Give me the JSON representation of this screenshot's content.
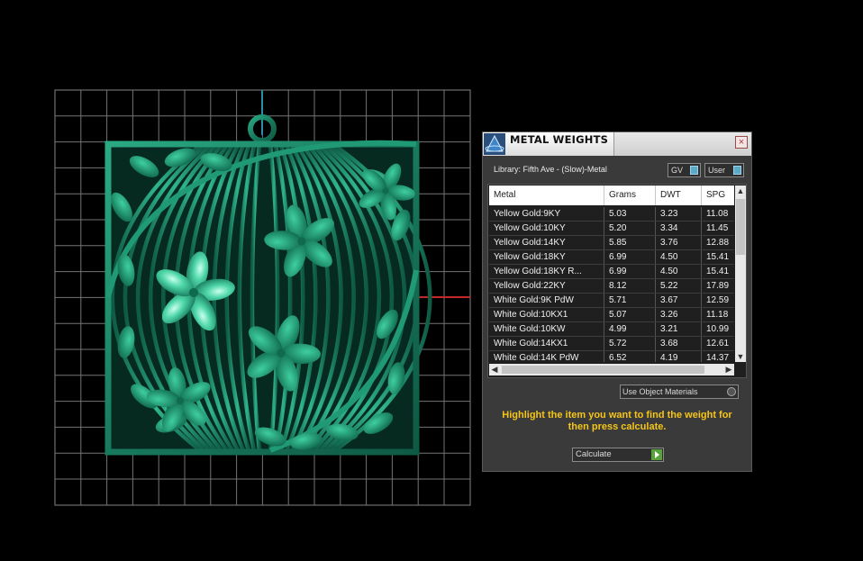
{
  "dialog": {
    "title": "METAL WEIGHTS",
    "close_icon": "close-icon",
    "library_label": "Library: Fifth Ave - (Slow)-Metal",
    "gv_toggle": "GV",
    "user_toggle": "User",
    "use_object_materials": "Use Object Materials",
    "instructions": "Highlight the item you want to find the weight for then press calculate.",
    "calculate_label": "Calculate"
  },
  "table": {
    "headers": [
      "Metal",
      "Grams",
      "DWT",
      "SPG"
    ],
    "rows": [
      [
        "Yellow Gold:9KY",
        "5.03",
        "3.23",
        "11.08"
      ],
      [
        "Yellow Gold:10KY",
        "5.20",
        "3.34",
        "11.45"
      ],
      [
        "Yellow Gold:14KY",
        "5.85",
        "3.76",
        "12.88"
      ],
      [
        "Yellow Gold:18KY",
        "6.99",
        "4.50",
        "15.41"
      ],
      [
        "Yellow Gold:18KY R...",
        "6.99",
        "4.50",
        "15.41"
      ],
      [
        "Yellow Gold:22KY",
        "8.12",
        "5.22",
        "17.89"
      ],
      [
        "White Gold:9K PdW",
        "5.71",
        "3.67",
        "12.59"
      ],
      [
        "White Gold:10KX1",
        "5.07",
        "3.26",
        "11.18"
      ],
      [
        "White Gold:10KW",
        "4.99",
        "3.21",
        "10.99"
      ],
      [
        "White Gold:14KX1",
        "5.72",
        "3.68",
        "12.61"
      ],
      [
        "White Gold:14K PdW",
        "6.52",
        "4.19",
        "14.37"
      ]
    ]
  },
  "colors": {
    "viewport_bg": "#000000",
    "grid_line": "#8a8a8a",
    "model_green": "#1e8a6a",
    "axis_red": "#c0282a",
    "axis_blue": "#2a8fa6",
    "instruction_yellow": "#f5c518"
  }
}
